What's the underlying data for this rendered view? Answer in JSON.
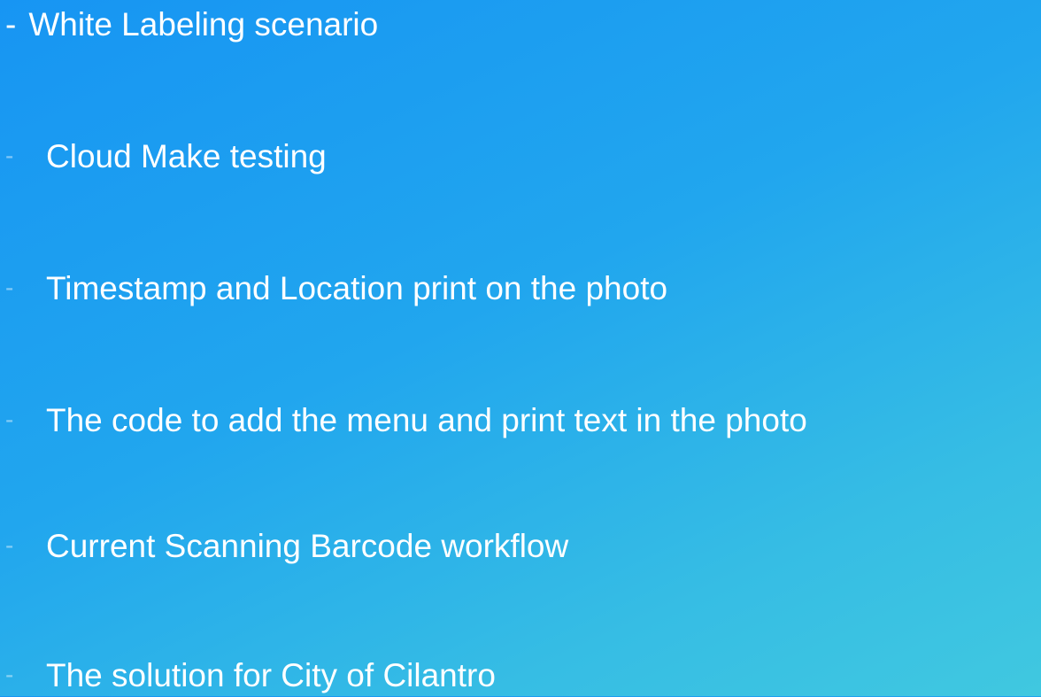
{
  "slide": {
    "bullets": [
      {
        "marker": "-",
        "text": "White Labeling scenario"
      },
      {
        "marker": "-",
        "text": "Cloud Make testing"
      },
      {
        "marker": "-",
        "text": "Timestamp and Location print on the photo"
      },
      {
        "marker": "-",
        "text": "The code to add the menu and print text in the photo"
      },
      {
        "marker": "-",
        "text": "Current Scanning Barcode workflow"
      },
      {
        "marker": "-",
        "text": "The solution for City of Cilantro"
      }
    ]
  },
  "colors": {
    "background_start": "#1795f3",
    "background_end": "#40c8e0",
    "text": "#ffffff"
  }
}
